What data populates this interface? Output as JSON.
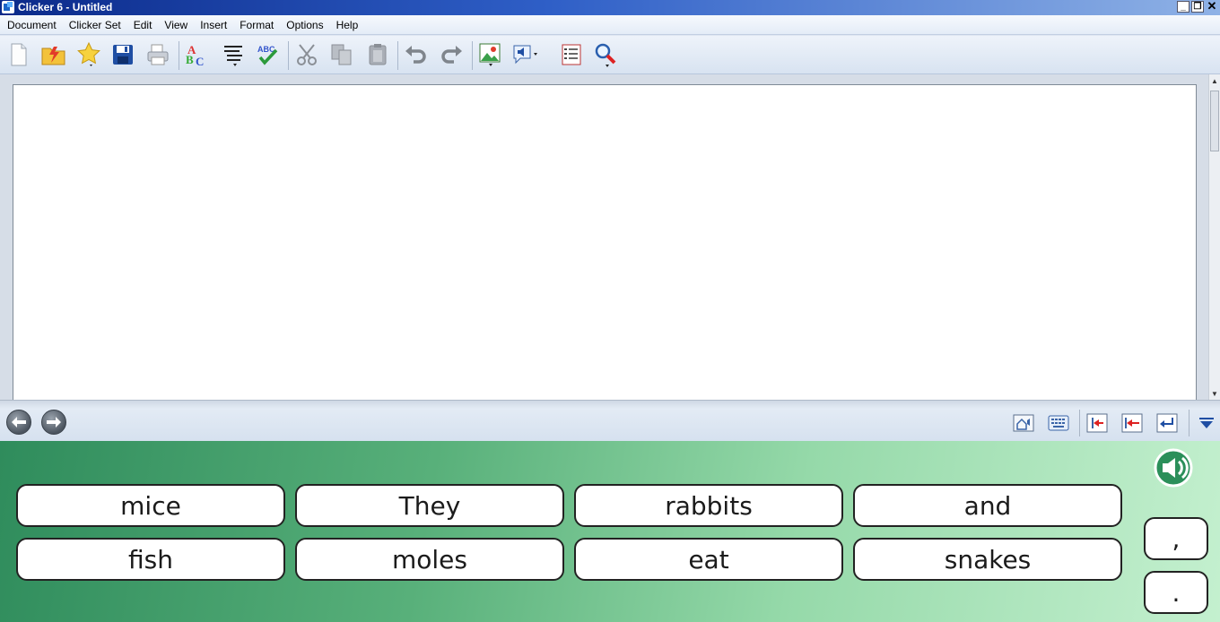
{
  "window": {
    "title": "Clicker 6 - Untitled"
  },
  "menu": [
    "Document",
    "Clicker Set",
    "Edit",
    "View",
    "Insert",
    "Format",
    "Options",
    "Help"
  ],
  "toolbar_icons": [
    "new-document-icon",
    "open-folder-icon",
    "favourites-star-icon",
    "save-icon",
    "print-icon",
    "spelling-abc-icon",
    "text-lines-icon",
    "spellcheck-abc-icon",
    "cut-icon",
    "copy-icon",
    "paste-icon",
    "undo-icon",
    "redo-icon",
    "picture-icon",
    "speech-icon",
    "list-icon",
    "magnifier-icon"
  ],
  "grid": {
    "words": [
      "mice",
      "They",
      "rabbits",
      "and",
      "fish",
      "moles",
      "eat",
      "snakes"
    ],
    "punctuation": [
      ",",
      "."
    ]
  },
  "colors": {
    "grid_start": "#2f8c5c",
    "grid_end": "#c4f0cf"
  }
}
